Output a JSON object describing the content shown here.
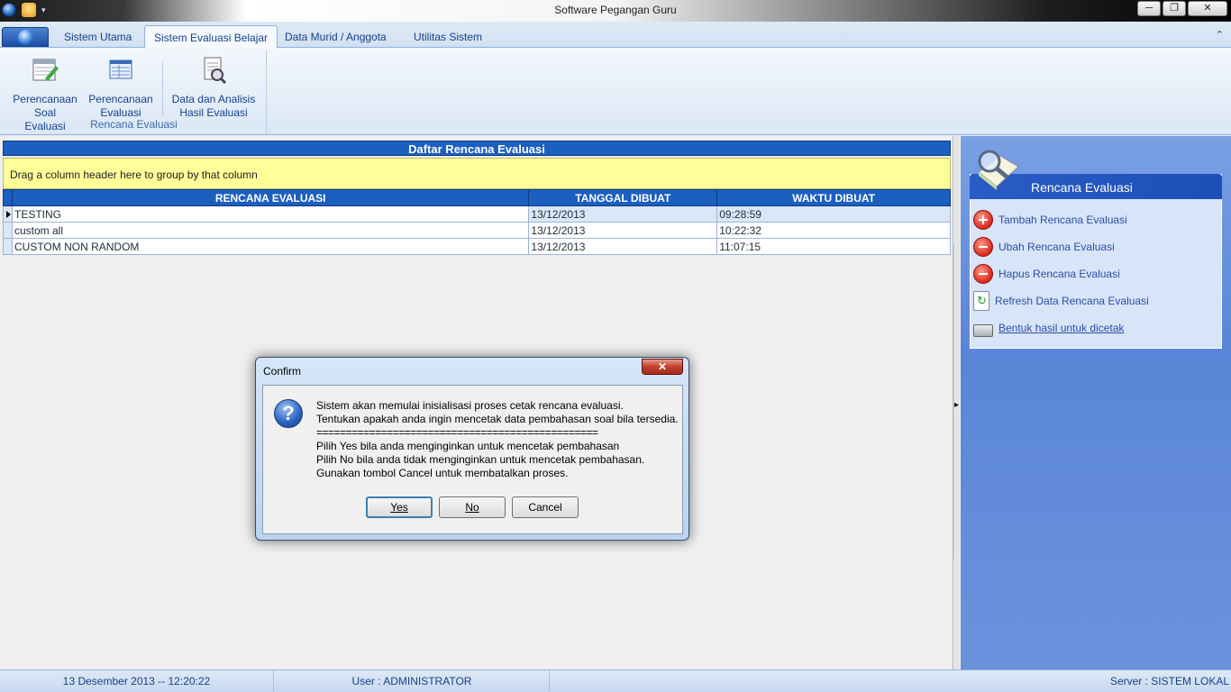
{
  "window": {
    "title": "Software Pegangan Guru",
    "controls": [
      "─",
      "❐",
      "✕"
    ]
  },
  "ribbon": {
    "tabs": [
      "Sistem Utama",
      "Sistem Evaluasi Belajar",
      "Data Murid / Anggota",
      "Utilitas Sistem"
    ],
    "active_tab": "Sistem Evaluasi Belajar",
    "collapse_icon": "⌃",
    "group_label": "Rencana Evaluasi",
    "buttons": [
      {
        "line1": "Perencanaan",
        "line2": "Soal Evaluasi"
      },
      {
        "line1": "Perencanaan",
        "line2": "Evaluasi"
      },
      {
        "line1": "Data dan Analisis",
        "line2": "Hasil Evaluasi"
      }
    ]
  },
  "grid": {
    "title": "Daftar Rencana Evaluasi",
    "group_hint": "Drag a column header here to group by that column",
    "columns": [
      "RENCANA EVALUASI",
      "TANGGAL DIBUAT",
      "WAKTU DIBUAT"
    ],
    "rows": [
      {
        "name": "TESTING",
        "date": "13/12/2013",
        "time": "09:28:59"
      },
      {
        "name": "custom all",
        "date": "13/12/2013",
        "time": "10:22:32"
      },
      {
        "name": "CUSTOM NON RANDOM",
        "date": "13/12/2013",
        "time": "11:07:15"
      }
    ]
  },
  "taskpane": {
    "title": "Rencana Evaluasi",
    "items": [
      {
        "label": "Tambah Rencana Evaluasi"
      },
      {
        "label": "Ubah Rencana Evaluasi"
      },
      {
        "label": "Hapus Rencana Evaluasi"
      },
      {
        "label": "Refresh Data Rencana Evaluasi"
      },
      {
        "label": "Bentuk hasil untuk dicetak"
      }
    ]
  },
  "statusbar": {
    "datetime": "13 Desember 2013 -- 12:20:22",
    "user": "User : ADMINISTRATOR",
    "server": "Server : SISTEM LOKAL"
  },
  "dialog": {
    "title": "Confirm",
    "close": "✕",
    "icon_glyph": "?",
    "lines": [
      "Sistem akan memulai inisialisasi proses cetak rencana evaluasi.",
      "Tentukan apakah anda ingin mencetak data pembahasan soal bila tersedia.",
      "================================================",
      "Pilih Yes bila anda menginginkan untuk mencetak pembahasan",
      "Pilih No bila anda tidak menginginkan untuk mencetak pembahasan.",
      "Gunakan tombol Cancel untuk membatalkan proses."
    ],
    "buttons": {
      "yes": "Yes",
      "no": "No",
      "cancel": "Cancel"
    }
  }
}
